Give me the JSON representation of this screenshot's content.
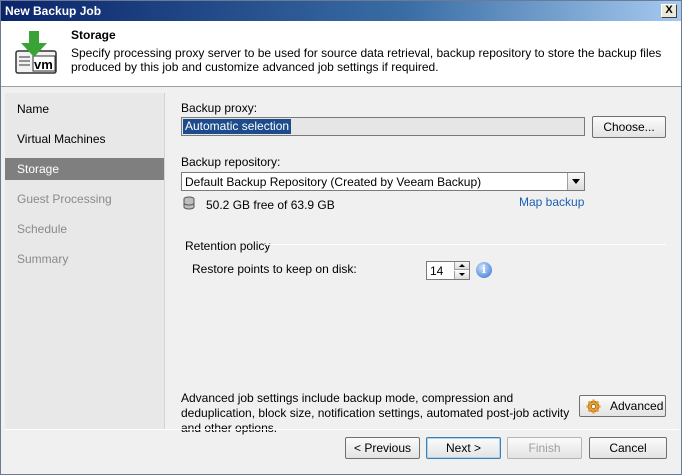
{
  "window": {
    "title": "New Backup Job",
    "close_glyph": "X"
  },
  "header": {
    "title": "Storage",
    "description": "Specify processing proxy server to be used for source data retrieval, backup repository to store the backup files produced by this job and customize advanced job settings if required.",
    "icon_label": "vm",
    "icon": "vm-download-icon",
    "accent_green": "#3aa335"
  },
  "sidebar": {
    "items": [
      {
        "label": "Name",
        "state": "normal"
      },
      {
        "label": "Virtual Machines",
        "state": "normal"
      },
      {
        "label": "Storage",
        "state": "active"
      },
      {
        "label": "Guest Processing",
        "state": "disabled"
      },
      {
        "label": "Schedule",
        "state": "disabled"
      },
      {
        "label": "Summary",
        "state": "disabled"
      }
    ]
  },
  "storage": {
    "proxy_label": "Backup proxy:",
    "proxy_value": "Automatic selection",
    "choose_button": "Choose...",
    "repository_label": "Backup repository:",
    "repository_value": "Default Backup Repository (Created by Veeam Backup)",
    "free_space": "50.2 GB free of 63.9 GB",
    "map_backup_link": "Map backup",
    "retention_label": "Retention policy",
    "restore_points_label": "Restore points to keep on disk:",
    "restore_points_value": "14",
    "info_glyph": "i",
    "advanced_text": "Advanced job settings include backup mode, compression and deduplication, block size, notification settings, automated post-job activity and other options.",
    "advanced_button": "Advanced"
  },
  "footer": {
    "previous": "< Previous",
    "next": "Next >",
    "finish": "Finish",
    "cancel": "Cancel"
  }
}
